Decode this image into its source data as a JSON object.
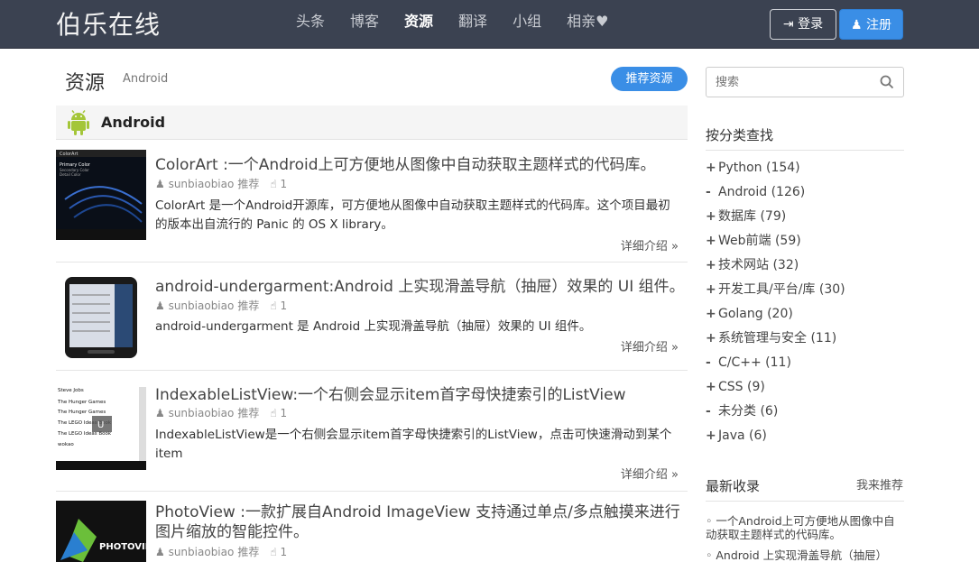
{
  "nav": {
    "brand": "伯乐在线",
    "items": [
      {
        "label": "头条"
      },
      {
        "label": "博客"
      },
      {
        "label": "资源"
      },
      {
        "label": "翻译"
      },
      {
        "label": "小组"
      },
      {
        "label": "相亲♥"
      }
    ],
    "login": "登录",
    "register": "注册"
  },
  "header": {
    "title": "资源",
    "crumb": "Android",
    "recommend": "推荐资源"
  },
  "category": {
    "label": "Android"
  },
  "items": [
    {
      "title": "ColorArt :一个Android上可方便地从图像中自动获取主题样式的代码库。",
      "author": "sunbiaobiao",
      "action": "推荐",
      "likes": "1",
      "desc": "ColorArt 是一个Android开源库，可方便地从图像中自动获取主题样式的代码库。这个项目最初的版本出自流行的 Panic 的 OS X library。",
      "more": "详细介绍 »",
      "thumb_text": [
        "ColorArt",
        "Primary Color",
        "Secondary Color",
        "Detail Color"
      ]
    },
    {
      "title": "android-undergarment:Android 上实现滑盖导航（抽屉）效果的 UI 组件。",
      "author": "sunbiaobiao",
      "action": "推荐",
      "likes": "1",
      "desc": "android-undergarment 是 Android 上实现滑盖导航（抽屉）效果的 UI 组件。",
      "more": "详细介绍 »"
    },
    {
      "title": "IndexableListView:一个右侧会显示item首字母快捷索引的ListView",
      "author": "sunbiaobiao",
      "action": "推荐",
      "likes": "1",
      "desc": "IndexableListView是一个右侧会显示item首字母快捷索引的ListView，点击可快速滑动到某个item",
      "more": "详细介绍 »",
      "thumb_text": [
        "Steve Jobs",
        "The Hunger Games",
        "The Hunger Games",
        "The LEGO Ideas Book",
        "The LEGO Ideas Book",
        "wokao",
        "U"
      ]
    },
    {
      "title": "PhotoView :一款扩展自Android ImageView 支持通过单点/多点触摸来进行图片缩放的智能控件。",
      "author": "sunbiaobiao",
      "action": "推荐",
      "likes": "1",
      "thumb_text": [
        "PHOTOVIEW"
      ]
    }
  ],
  "sidebar": {
    "search_placeholder": "搜索",
    "cat_title": "按分类查找",
    "categories": [
      {
        "mark": "+",
        "label": "Python (154)"
      },
      {
        "mark": "-",
        "label": "Android (126)"
      },
      {
        "mark": "+",
        "label": "数据库 (79)"
      },
      {
        "mark": "+",
        "label": "Web前端 (59)"
      },
      {
        "mark": "+",
        "label": "技术网站 (32)"
      },
      {
        "mark": "+",
        "label": "开发工具/平台/库 (30)"
      },
      {
        "mark": "+",
        "label": "Golang (20)"
      },
      {
        "mark": "+",
        "label": "系统管理与安全 (11)"
      },
      {
        "mark": "-",
        "label": "C/C++ (11)"
      },
      {
        "mark": "+",
        "label": "CSS (9)"
      },
      {
        "mark": "-",
        "label": "未分类 (6)"
      },
      {
        "mark": "+",
        "label": "Java (6)"
      }
    ],
    "latest_title": "最新收录",
    "my_recommend": "我来推荐",
    "latest_items": [
      "◦ 一个Android上可方便地从图像中自动获取主题样式的代码库。",
      "◦ Android 上实现滑盖导航（抽屉）"
    ]
  },
  "colors": {
    "topbar": "#3b4251",
    "accent": "#3a8ee6",
    "android_green": "#a4c639"
  }
}
